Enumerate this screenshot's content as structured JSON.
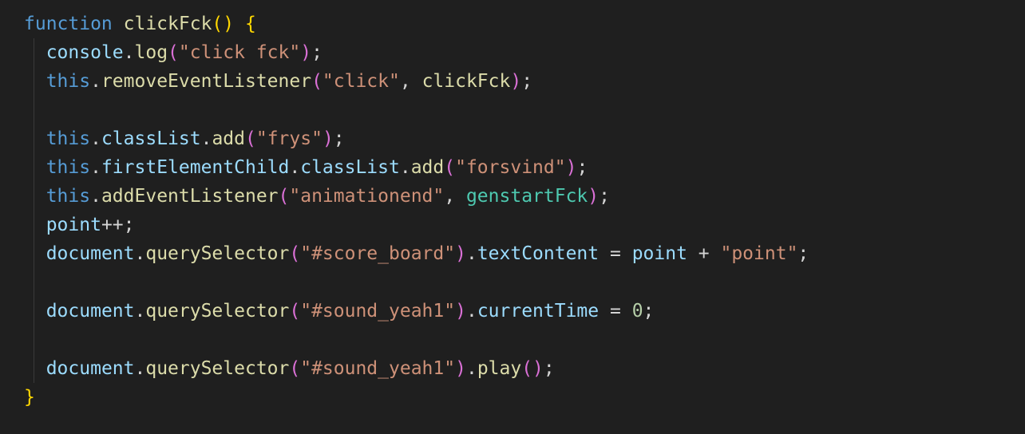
{
  "editor": {
    "background": "#1f1f1f",
    "lines": [
      [
        [
          "kw",
          "function"
        ],
        [
          "op",
          " "
        ],
        [
          "fn",
          "clickFck"
        ],
        [
          "brk1",
          "()"
        ],
        [
          "op",
          " "
        ],
        [
          "brk1",
          "{"
        ]
      ],
      [
        [
          "op",
          "  "
        ],
        [
          "var",
          "console"
        ],
        [
          "op",
          "."
        ],
        [
          "fn",
          "log"
        ],
        [
          "brk2",
          "("
        ],
        [
          "str",
          "\"click fck\""
        ],
        [
          "brk2",
          ")"
        ],
        [
          "op",
          ";"
        ]
      ],
      [
        [
          "op",
          "  "
        ],
        [
          "kw",
          "this"
        ],
        [
          "op",
          "."
        ],
        [
          "fn",
          "removeEventListener"
        ],
        [
          "brk2",
          "("
        ],
        [
          "str",
          "\"click\""
        ],
        [
          "op",
          ", "
        ],
        [
          "fn",
          "clickFck"
        ],
        [
          "brk2",
          ")"
        ],
        [
          "op",
          ";"
        ]
      ],
      [],
      [
        [
          "op",
          "  "
        ],
        [
          "kw",
          "this"
        ],
        [
          "op",
          "."
        ],
        [
          "var",
          "classList"
        ],
        [
          "op",
          "."
        ],
        [
          "fn",
          "add"
        ],
        [
          "brk2",
          "("
        ],
        [
          "str",
          "\"frys\""
        ],
        [
          "brk2",
          ")"
        ],
        [
          "op",
          ";"
        ]
      ],
      [
        [
          "op",
          "  "
        ],
        [
          "kw",
          "this"
        ],
        [
          "op",
          "."
        ],
        [
          "var",
          "firstElementChild"
        ],
        [
          "op",
          "."
        ],
        [
          "var",
          "classList"
        ],
        [
          "op",
          "."
        ],
        [
          "fn",
          "add"
        ],
        [
          "brk2",
          "("
        ],
        [
          "str",
          "\"forsvind\""
        ],
        [
          "brk2",
          ")"
        ],
        [
          "op",
          ";"
        ]
      ],
      [
        [
          "op",
          "  "
        ],
        [
          "kw",
          "this"
        ],
        [
          "op",
          "."
        ],
        [
          "fn",
          "addEventListener"
        ],
        [
          "brk2",
          "("
        ],
        [
          "str",
          "\"animationend\""
        ],
        [
          "op",
          ", "
        ],
        [
          "ref",
          "genstartFck"
        ],
        [
          "brk2",
          ")"
        ],
        [
          "op",
          ";"
        ]
      ],
      [
        [
          "op",
          "  "
        ],
        [
          "var",
          "point"
        ],
        [
          "op",
          "++;"
        ]
      ],
      [
        [
          "op",
          "  "
        ],
        [
          "var",
          "document"
        ],
        [
          "op",
          "."
        ],
        [
          "fn",
          "querySelector"
        ],
        [
          "brk2",
          "("
        ],
        [
          "str",
          "\"#score_board\""
        ],
        [
          "brk2",
          ")"
        ],
        [
          "op",
          "."
        ],
        [
          "var",
          "textContent"
        ],
        [
          "op",
          " = "
        ],
        [
          "var",
          "point"
        ],
        [
          "op",
          " + "
        ],
        [
          "str",
          "\"point\""
        ],
        [
          "op",
          ";"
        ]
      ],
      [],
      [
        [
          "op",
          "  "
        ],
        [
          "var",
          "document"
        ],
        [
          "op",
          "."
        ],
        [
          "fn",
          "querySelector"
        ],
        [
          "brk2",
          "("
        ],
        [
          "str",
          "\"#sound_yeah1\""
        ],
        [
          "brk2",
          ")"
        ],
        [
          "op",
          "."
        ],
        [
          "var",
          "currentTime"
        ],
        [
          "op",
          " = "
        ],
        [
          "num",
          "0"
        ],
        [
          "op",
          ";"
        ]
      ],
      [],
      [
        [
          "op",
          "  "
        ],
        [
          "var",
          "document"
        ],
        [
          "op",
          "."
        ],
        [
          "fn",
          "querySelector"
        ],
        [
          "brk2",
          "("
        ],
        [
          "str",
          "\"#sound_yeah1\""
        ],
        [
          "brk2",
          ")"
        ],
        [
          "op",
          "."
        ],
        [
          "fn",
          "play"
        ],
        [
          "brk2",
          "()"
        ],
        [
          "op",
          ";"
        ]
      ],
      [
        [
          "brk1",
          "}"
        ]
      ]
    ]
  }
}
